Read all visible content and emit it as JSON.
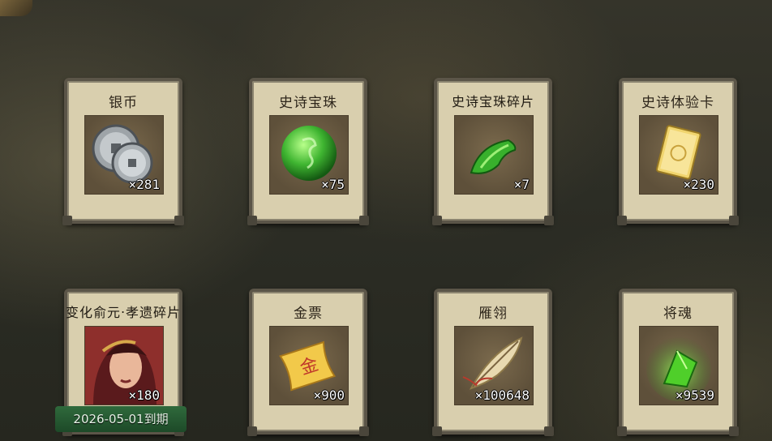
{
  "items": [
    {
      "name": "银币",
      "count": "×281",
      "icon": "silver-coin-icon"
    },
    {
      "name": "史诗宝珠",
      "count": "×75",
      "icon": "green-orb-icon"
    },
    {
      "name": "史诗宝珠碎片",
      "count": "×7",
      "icon": "orb-shard-icon"
    },
    {
      "name": "史诗体验卡",
      "count": "×230",
      "icon": "gold-card-icon"
    },
    {
      "name": "变化俞元‧孝遗碎片",
      "count": "×180",
      "icon": "hero-portrait-icon"
    },
    {
      "name": "金票",
      "count": "×900",
      "icon": "gold-ticket-icon"
    },
    {
      "name": "雁翎",
      "count": "×100648",
      "icon": "feather-icon"
    },
    {
      "name": "将魂",
      "count": "×9539",
      "icon": "general-soul-icon"
    }
  ],
  "expiry_label": "2026-05-01到期",
  "colors": {
    "card_bg": "#d9cfae",
    "frame": "#5b5548",
    "expiry_bg": "#2f6a3c"
  }
}
